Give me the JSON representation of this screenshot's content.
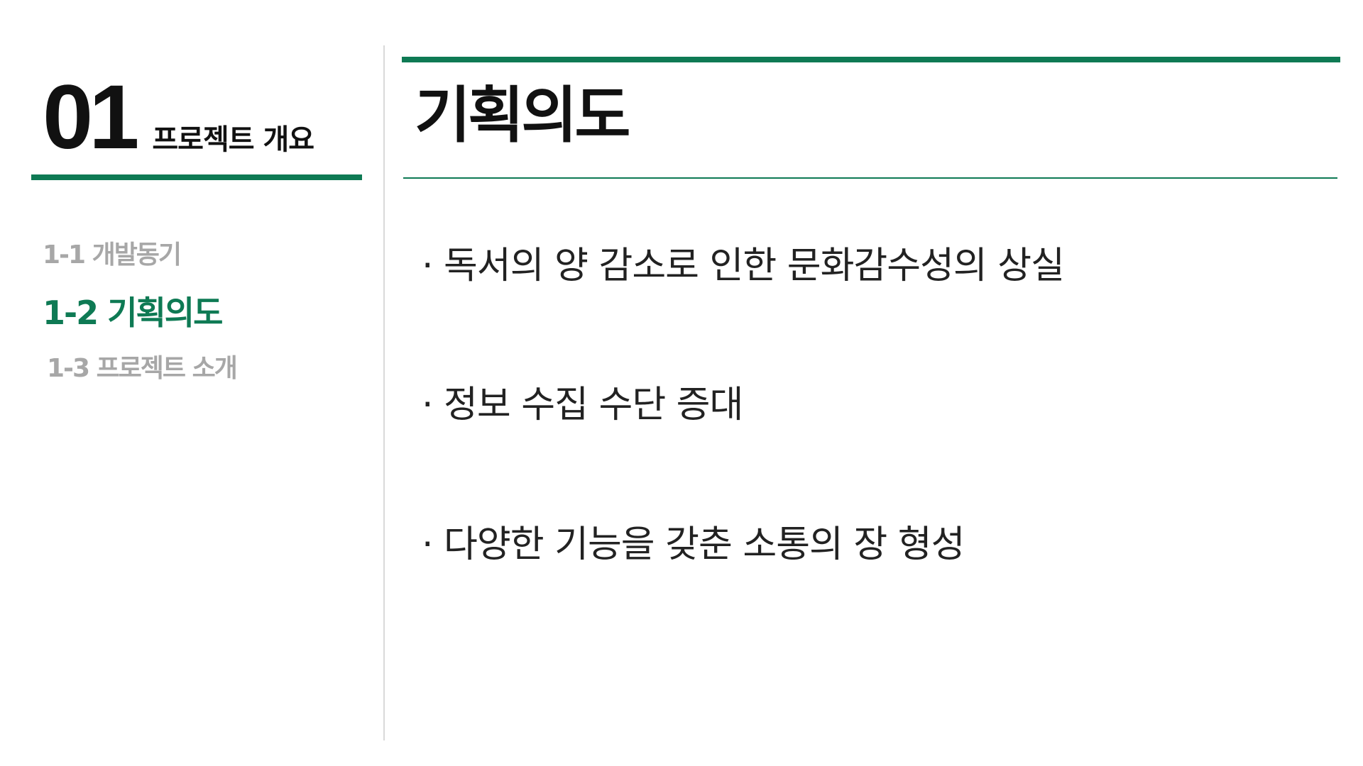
{
  "section": {
    "number": "01",
    "title": "프로젝트 개요"
  },
  "nav": {
    "items": [
      {
        "label": "1-1 개발동기",
        "state": "inactive"
      },
      {
        "label": "1-2 기획의도",
        "state": "active"
      },
      {
        "label": "1-3 프로젝트 소개",
        "state": "inactive"
      }
    ]
  },
  "content": {
    "title": "기획의도",
    "bullets": [
      "· 독서의 양 감소로 인한 문화감수성의 상실",
      "· 정보 수집 수단 증대",
      "· 다양한 기능을 갖춘 소통의 장 형성"
    ]
  },
  "colors": {
    "accent": "#0e7a54",
    "inactive_text": "#a7a7a7",
    "text": "#111111",
    "divider": "#d9d9d9"
  }
}
